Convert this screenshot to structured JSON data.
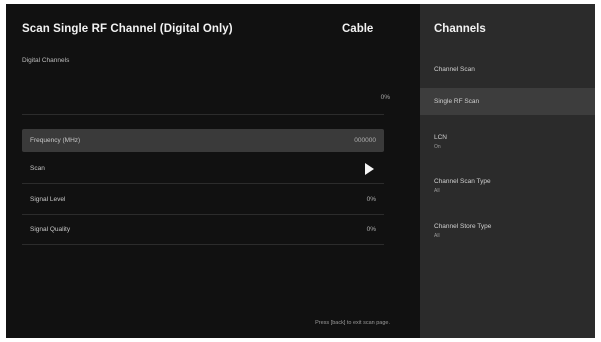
{
  "main": {
    "title": "Scan Single RF Channel  (Digital Only)",
    "mode": "Cable",
    "digital_channels_label": "Digital Channels",
    "digital_channels_value": "0%",
    "rows": [
      {
        "label": "Frequency (MHz)",
        "value": "000000"
      },
      {
        "label": "Scan",
        "value": ""
      },
      {
        "label": "Signal Level",
        "value": "0%"
      },
      {
        "label": "Signal Quality",
        "value": "0%"
      }
    ],
    "hint": "Press [back] to exit scan page."
  },
  "side": {
    "title": "Channels",
    "items": [
      {
        "label": "Channel Scan",
        "sub": ""
      },
      {
        "label": "Single RF Scan",
        "sub": ""
      },
      {
        "label": "LCN",
        "sub": "On"
      },
      {
        "label": "Channel Scan Type",
        "sub": "All"
      },
      {
        "label": "Channel Store Type",
        "sub": "All"
      }
    ]
  },
  "colors": {
    "panel_background": "#111111",
    "side_background": "#2b2b2b",
    "highlight": "#3a3a3a"
  },
  "icons": {
    "scan": "play-icon"
  }
}
